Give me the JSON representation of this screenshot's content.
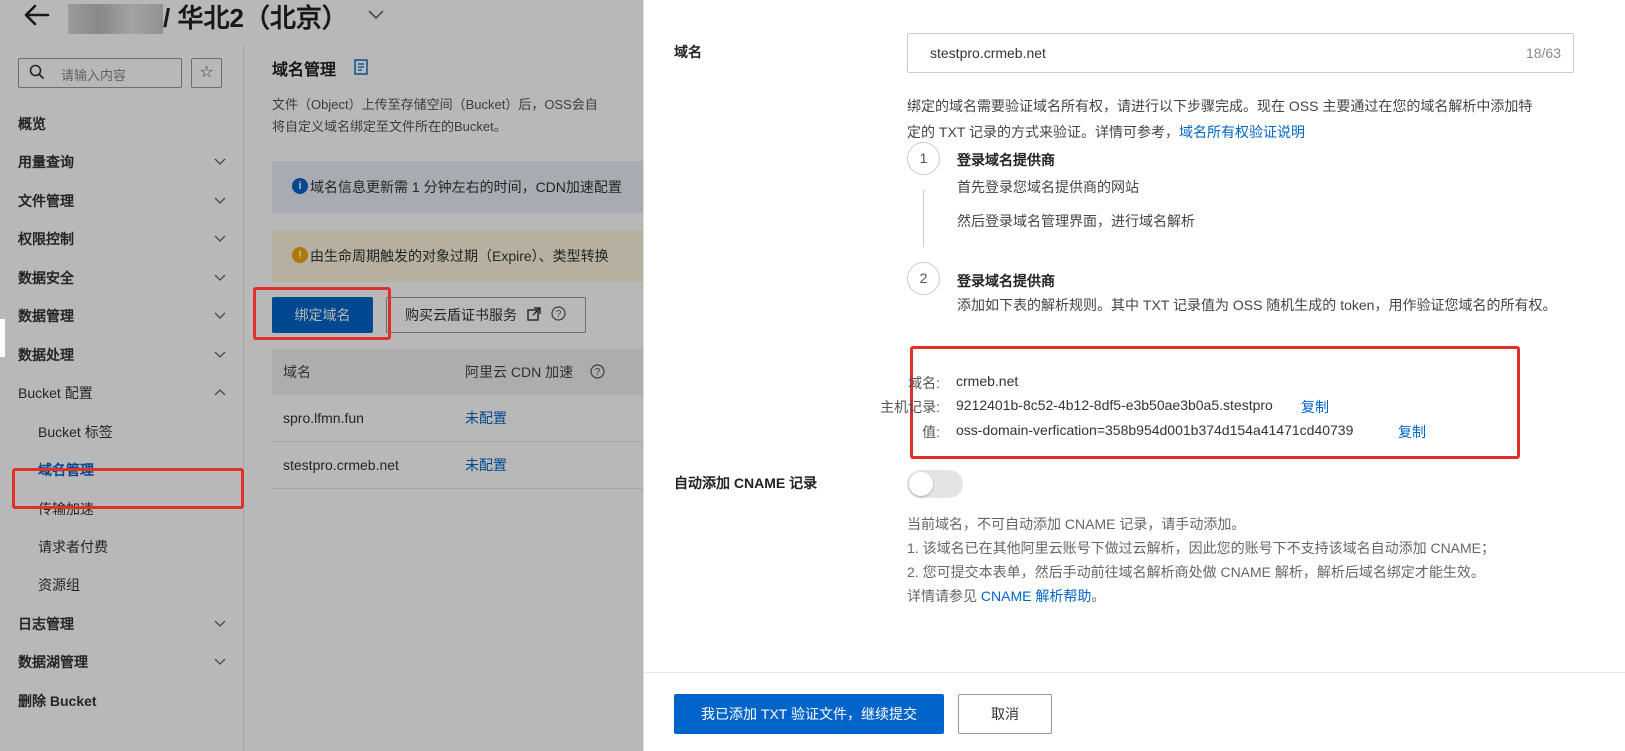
{
  "header": {
    "region_title": "/ 华北2（北京）"
  },
  "sidebar": {
    "search_placeholder": "请输入内容",
    "items": [
      {
        "label": "概览"
      },
      {
        "label": "用量查询"
      },
      {
        "label": "文件管理"
      },
      {
        "label": "权限控制"
      },
      {
        "label": "数据安全"
      },
      {
        "label": "数据管理"
      },
      {
        "label": "数据处理"
      },
      {
        "label": "Bucket 配置"
      },
      {
        "label": "Bucket 标签"
      },
      {
        "label": "域名管理"
      },
      {
        "label": "传输加速"
      },
      {
        "label": "请求者付费"
      },
      {
        "label": "资源组"
      },
      {
        "label": "日志管理"
      },
      {
        "label": "数据湖管理"
      },
      {
        "label": "删除 Bucket"
      }
    ]
  },
  "main": {
    "title": "域名管理",
    "desc_line1": "文件（Object）上传至存储空间（Bucket）后，OSS会自",
    "desc_line2": "将自定义域名绑定至文件所在的Bucket。",
    "info_banner": "域名信息更新需 1 分钟左右的时间，CDN加速配置",
    "warn_banner": "由生命周期触发的对象过期（Expire）、类型转换",
    "bind_button": "绑定域名",
    "buy_button": "购买云盾证书服务",
    "table": {
      "headers": [
        "域名",
        "阿里云 CDN 加速"
      ],
      "rows": [
        {
          "domain": "spro.lfmn.fun",
          "cdn": "未配置"
        },
        {
          "domain": "stestpro.crmeb.net",
          "cdn": "未配置"
        }
      ]
    }
  },
  "drawer": {
    "domain_label": "域名",
    "domain_value": "stestpro.crmeb.net",
    "domain_count": "18/63",
    "help_line1": "绑定的域名需要验证域名所有权，请进行以下步骤完成。现在 OSS 主要通过在您的域名解析中添加特",
    "help_line2": "定的 TXT 记录的方式来验证。详情可参考，",
    "help_link": "域名所有权验证说明",
    "step1": {
      "num": "1",
      "title": "登录域名提供商",
      "text1": "首先登录您域名提供商的网站",
      "text2": "然后登录域名管理界面，进行域名解析"
    },
    "step2": {
      "num": "2",
      "title": "登录域名提供商",
      "text": "添加如下表的解析规则。其中 TXT 记录值为 OSS 随机生成的 token，用作验证您域名的所有权。"
    },
    "record": {
      "domain_key": "域名:",
      "domain_val": "crmeb.net",
      "host_key": "主机记录:",
      "host_val": "9212401b-8c52-4b12-8df5-e3b50ae3b0a5.stestpro",
      "value_key": "值:",
      "value_val": "oss-domain-verfication=358b954d001b374d154a41471cd40739",
      "copy": "复制"
    },
    "cname_label": "自动添加 CNAME 记录",
    "cname_enabled": false,
    "notes": {
      "line0": "当前域名，不可自动添加 CNAME 记录，请手动添加。",
      "line1": "1. 该域名已在其他阿里云账号下做过云解析，因此您的账号下不支持该域名自动添加 CNAME；",
      "line2": "2. 您可提交本表单，然后手动前往域名解析商处做 CNAME 解析，解析后域名绑定才能生效。",
      "line3_prefix": "详情请参见 ",
      "line3_link": "CNAME 解析帮助",
      "line3_suffix": "。"
    },
    "submit_button": "我已添加 TXT 验证文件，继续提交",
    "cancel_button": "取消"
  },
  "colors": {
    "primary": "#0064c8",
    "highlight_frame": "#e0302a"
  }
}
